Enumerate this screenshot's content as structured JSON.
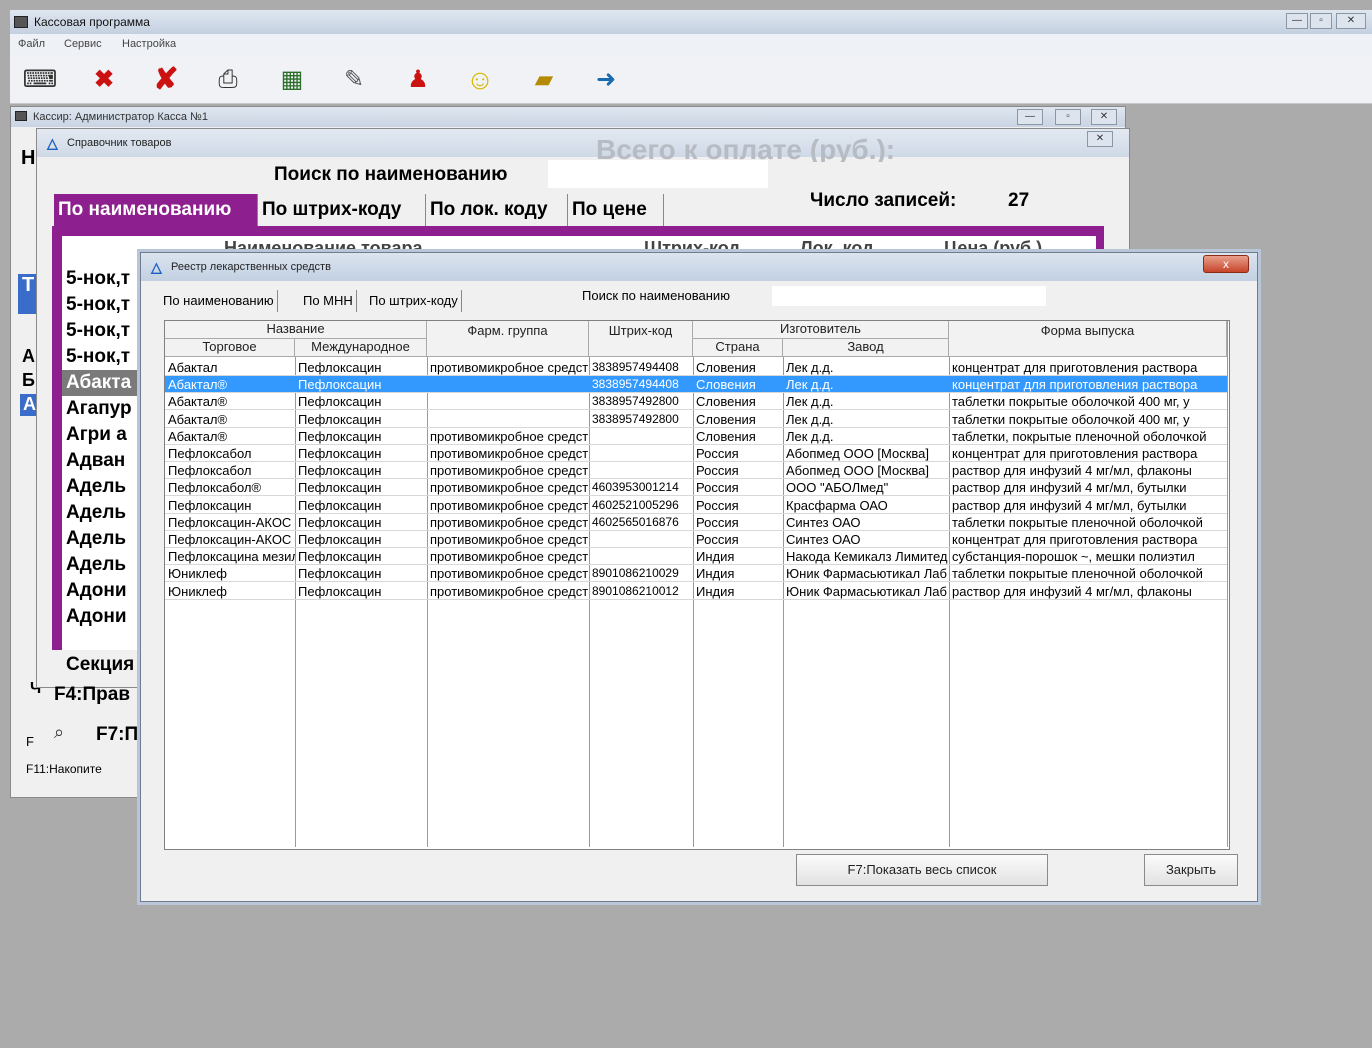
{
  "main": {
    "title": "Кассовая программа",
    "menu": [
      "Файл",
      "Сервис",
      "Настройка"
    ]
  },
  "toolbar": {
    "icons": [
      "cash-register-icon",
      "close-x-icon",
      "delete-x-icon",
      "printer-icon",
      "calculator-icon",
      "book-icon",
      "people-icon",
      "smiley-icon",
      "folder-icon",
      "exit-icon"
    ]
  },
  "cashier": {
    "title": "Кассир: Администратор   Касса №1",
    "h_letter": "Н",
    "side_letters": [
      "Т",
      "А",
      "Б",
      "А"
    ],
    "bottom": {
      "section": "Секция",
      "f4": "F4:Прав",
      "f7": "F7:П",
      "f_label": "F",
      "f11": "F11:Накопите",
      "ch": "Ч"
    }
  },
  "goods": {
    "title": "Справочник товаров",
    "search_label": "Поиск по наименованию",
    "total_label": "Всего к оплате (руб.):",
    "count_label": "Число записей:",
    "count_value": "27",
    "tabs": [
      "По наименованию",
      "По штрих-коду",
      "По лок. коду",
      "По цене"
    ],
    "columns": [
      "Наименование товара",
      "Штрих-код",
      "Лок. код",
      "Цена (руб.)"
    ],
    "items": [
      "5-нок,т",
      "5-нок,т",
      "5-нок,т",
      "5-нок,т",
      "Абакта",
      "Агапур",
      "Агри а",
      "Адван",
      "Адель",
      "Адель",
      "Адель",
      "Адель",
      "Адони",
      "Адони"
    ]
  },
  "registry": {
    "title": "Реестр лекарственных средств",
    "close_glyph": "x",
    "tabs": [
      "По наименованию",
      "По МНН",
      "По штрих-коду"
    ],
    "search_label": "Поиск по наименованию",
    "headers": {
      "name": "Название",
      "trade": "Торговое",
      "intl": "Международное",
      "group": "Фарм. группа",
      "barcode": "Штрих-код",
      "maker": "Изготовитель",
      "country": "Страна",
      "plant": "Завод",
      "form": "Форма выпуска"
    },
    "rows": [
      [
        "Абактал",
        "Пефлоксацин",
        "противомикробное средство",
        "3838957494408",
        "Словения",
        "Лек д.д.",
        "концентрат для приготовления раствора"
      ],
      [
        "Абактал®",
        "Пефлоксацин",
        "",
        "3838957494408",
        "Словения",
        "Лек д.д.",
        "концентрат для приготовления раствора"
      ],
      [
        "Абактал®",
        "Пефлоксацин",
        "",
        "3838957492800",
        "Словения",
        "Лек д.д.",
        "таблетки покрытые оболочкой 400 мг, у"
      ],
      [
        "Абактал®",
        "Пефлоксацин",
        "",
        "3838957492800",
        "Словения",
        "Лек д.д.",
        "таблетки покрытые оболочкой 400 мг, у"
      ],
      [
        "Абактал®",
        "Пефлоксацин",
        "противомикробное средство",
        "",
        "Словения",
        "Лек д.д.",
        "таблетки, покрытые пленочной оболочкой"
      ],
      [
        "Пефлоксабол",
        "Пефлоксацин",
        "противомикробное средство",
        "",
        "Россия",
        "Абопмед ООО [Москва]",
        "концентрат для приготовления раствора"
      ],
      [
        "Пефлоксабол",
        "Пефлоксацин",
        "противомикробное средство",
        "",
        "Россия",
        "Абопмед ООО [Москва]",
        "раствор для инфузий 4 мг/мл, флаконы"
      ],
      [
        "Пефлоксабол®",
        "Пефлоксацин",
        "противомикробное средство",
        "4603953001214",
        "Россия",
        "ООО \"АБОЛмед\"",
        "раствор для инфузий 4 мг/мл, бутылки"
      ],
      [
        "Пефлоксацин",
        "Пефлоксацин",
        "противомикробное средство",
        "4602521005296",
        "Россия",
        "Красфарма ОАО",
        "раствор для инфузий 4 мг/мл, бутылки"
      ],
      [
        "Пефлоксацин-АКОС",
        "Пефлоксацин",
        "противомикробное средство",
        "4602565016876",
        "Россия",
        "Синтез ОАО",
        "таблетки покрытые пленочной оболочкой"
      ],
      [
        "Пефлоксацин-АКОС",
        "Пефлоксацин",
        "противомикробное средство",
        "",
        "Россия",
        "Синтез ОАО",
        "концентрат для приготовления раствора"
      ],
      [
        "Пефлоксацина мезилат",
        "Пефлоксацин",
        "противомикробное средство",
        "",
        "Индия",
        "Накода Кемикалз Лимитед",
        "субстанция-порошок ~, мешки полиэтил"
      ],
      [
        "Юниклеф",
        "Пефлоксацин",
        "противомикробное средство",
        "8901086210029",
        "Индия",
        "Юник Фармасьютикал Лаб",
        "таблетки покрытые пленочной оболочкой"
      ],
      [
        "Юниклеф",
        "Пефлоксацин",
        "противомикробное средство",
        "8901086210012",
        "Индия",
        "Юник Фармасьютикал Лаб",
        "раствор для инфузий 4 мг/мл, флаконы"
      ]
    ],
    "selected_row": 1,
    "show_all_label": "F7:Показать весь список",
    "close_label": "Закрыть"
  }
}
